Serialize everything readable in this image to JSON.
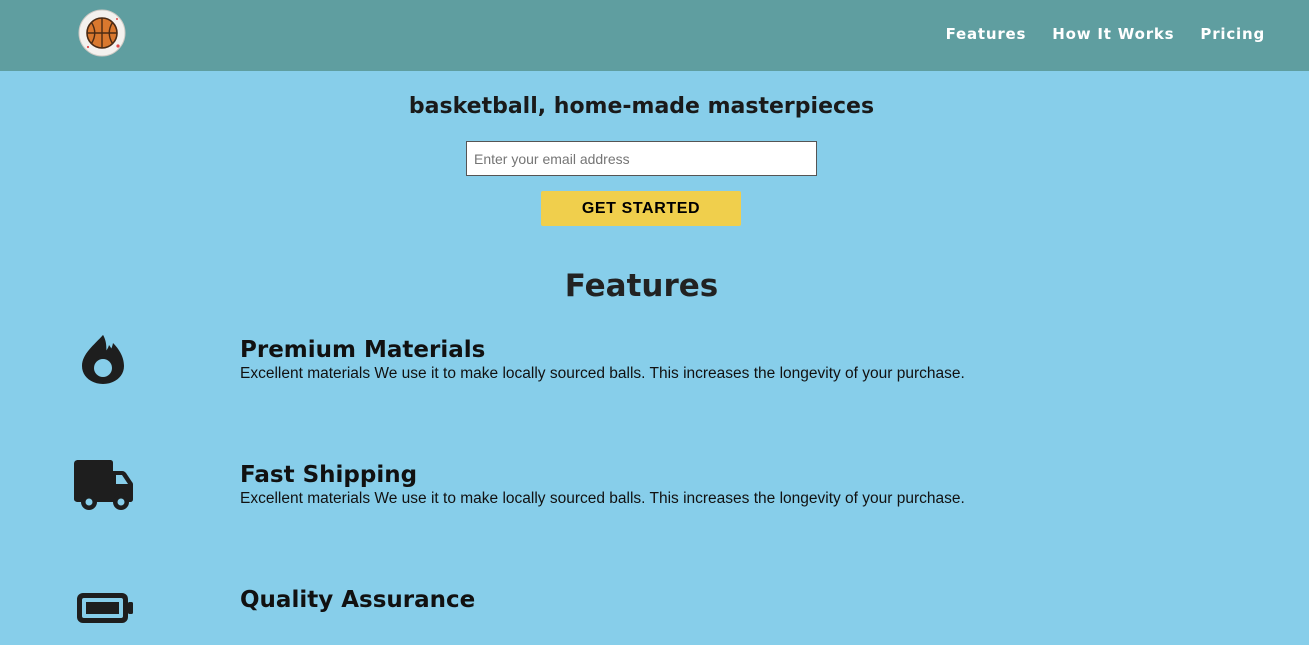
{
  "header": {
    "logo_icon": "basketball-logo-icon",
    "nav": [
      {
        "label": "Features"
      },
      {
        "label": "How It Works"
      },
      {
        "label": "Pricing"
      }
    ]
  },
  "hero": {
    "title": "basketball, home-made masterpieces",
    "email_placeholder": "Enter your email address",
    "email_value": "",
    "cta_label": "GET STARTED"
  },
  "features": {
    "title": "Features",
    "items": [
      {
        "icon": "fire-icon",
        "title": "Premium Materials",
        "description": "Excellent materials We use it to make locally sourced balls. This increases the longevity of your purchase."
      },
      {
        "icon": "truck-icon",
        "title": "Fast Shipping",
        "description": "Excellent materials We use it to make locally sourced balls. This increases the longevity of your purchase."
      },
      {
        "icon": "battery-icon",
        "title": "Quality Assurance"
      }
    ]
  },
  "colors": {
    "header_bg": "#5f9ea0",
    "page_bg": "#87ceea",
    "cta_bg": "#f0cf4c"
  }
}
